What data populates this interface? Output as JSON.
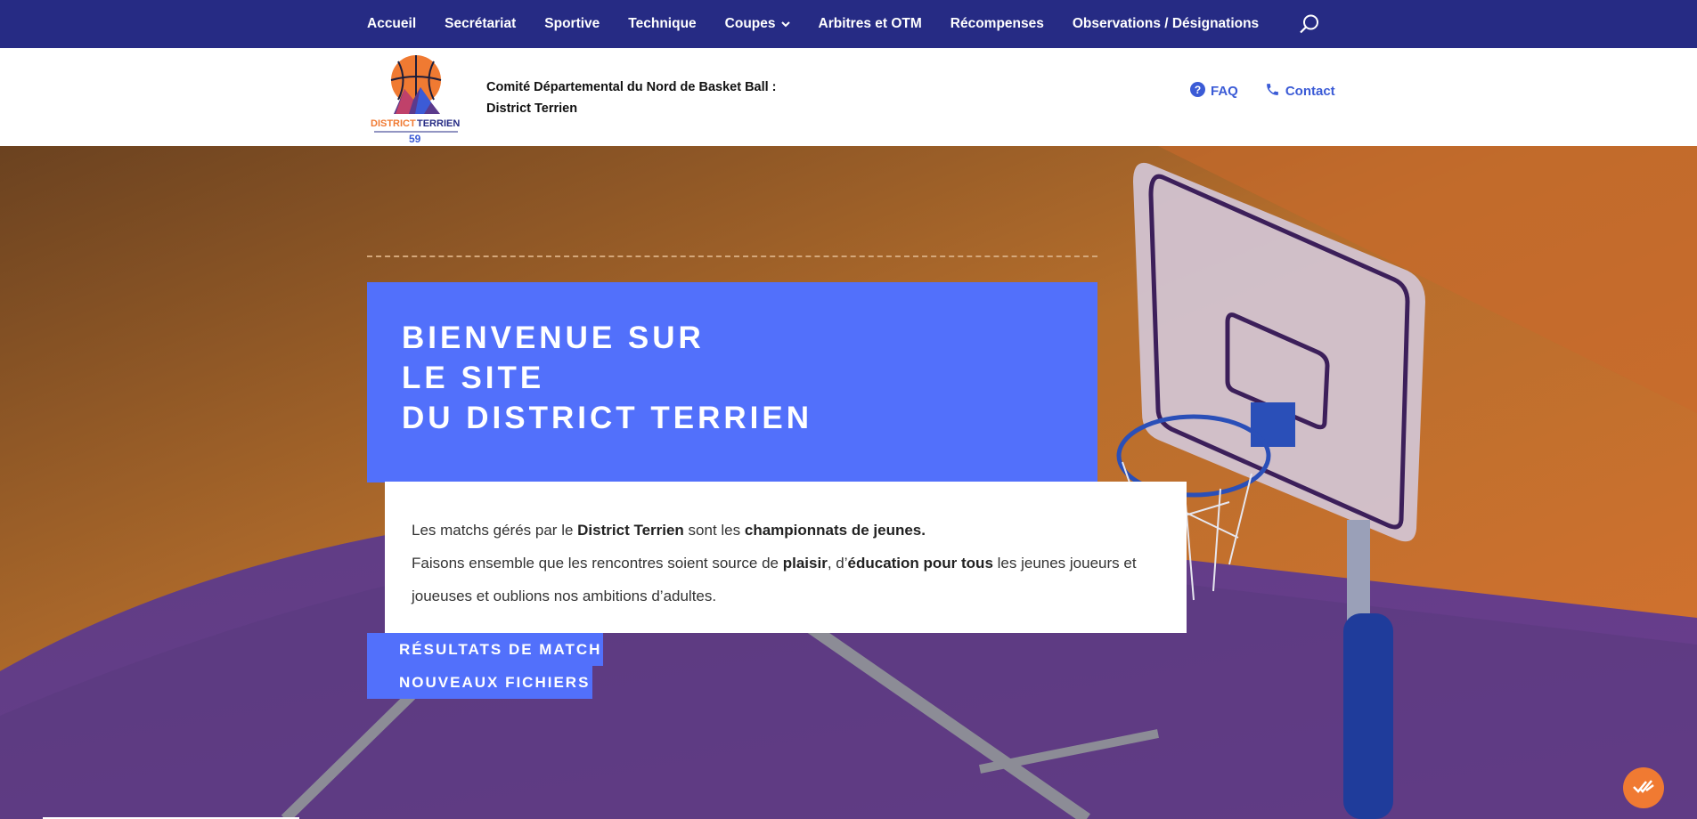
{
  "nav": {
    "items": [
      {
        "label": "Accueil"
      },
      {
        "label": "Secrétariat"
      },
      {
        "label": "Sportive"
      },
      {
        "label": "Technique"
      },
      {
        "label": "Coupes",
        "has_dropdown": true
      },
      {
        "label": "Arbitres et OTM"
      },
      {
        "label": "Récompenses"
      },
      {
        "label": "Observations / Désignations"
      }
    ],
    "search_icon": "search-icon"
  },
  "header": {
    "logo_text": "DISTRICT TERRIEN",
    "logo_number": "59",
    "title_line1": "Comité Départemental du Nord de Basket Ball :",
    "title_line2": "District Terrien",
    "faq_label": "FAQ",
    "contact_label": "Contact"
  },
  "hero": {
    "welcome_line1": "BIENVENUE SUR",
    "welcome_line2": "LE SITE",
    "welcome_line3": "DU DISTRICT TERRIEN",
    "text1_a": "Les matchs gérés par le ",
    "text1_b": "District Terrien",
    "text1_c": " sont les ",
    "text1_d": "championnats de jeunes.",
    "text2_a": "Faisons ensemble que les rencontres soient source de ",
    "text2_b": "plaisir",
    "text2_c": ", d’",
    "text2_d": "éducation pour tous",
    "text2_e": " les jeunes joueurs et joueuses et oublions nos ambitions d’adultes.",
    "btn_results": "RÉSULTATS DE MATCH",
    "btn_files": "NOUVEAUX FICHIERS"
  },
  "colors": {
    "nav_bg": "#262b84",
    "accent_blue": "#5270fb",
    "link_blue": "#3b5bd6",
    "float_orange": "#f07a32"
  }
}
